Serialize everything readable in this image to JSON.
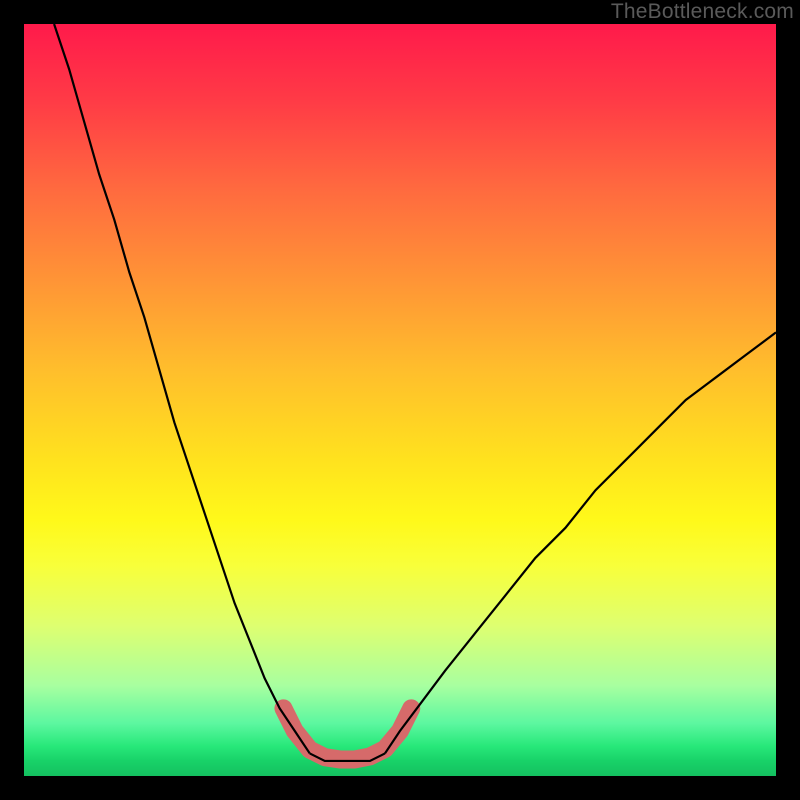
{
  "watermark": {
    "text": "TheBottleneck.com"
  },
  "chart_data": {
    "type": "line",
    "title": "",
    "xlabel": "",
    "ylabel": "",
    "xlim": [
      0,
      100
    ],
    "ylim": [
      0,
      100
    ],
    "grid": false,
    "legend": false,
    "annotations": [],
    "series": [
      {
        "name": "left-branch",
        "x": [
          4,
          6,
          8,
          10,
          12,
          14,
          16,
          18,
          20,
          22,
          24,
          26,
          28,
          30,
          32,
          34,
          36,
          38
        ],
        "y": [
          100,
          94,
          87,
          80,
          74,
          67,
          61,
          54,
          47,
          41,
          35,
          29,
          23,
          18,
          13,
          9,
          6,
          3
        ]
      },
      {
        "name": "flat-bottom",
        "x": [
          38,
          40,
          42,
          44,
          46,
          48
        ],
        "y": [
          3,
          2,
          2,
          2,
          2,
          3
        ]
      },
      {
        "name": "right-branch",
        "x": [
          48,
          50,
          53,
          56,
          60,
          64,
          68,
          72,
          76,
          80,
          84,
          88,
          92,
          96,
          100
        ],
        "y": [
          3,
          6,
          10,
          14,
          19,
          24,
          29,
          33,
          38,
          42,
          46,
          50,
          53,
          56,
          59
        ]
      },
      {
        "name": "highlight-u",
        "x": [
          34.5,
          36,
          38,
          40,
          42,
          44,
          46,
          48,
          50,
          51.5
        ],
        "y": [
          9,
          6,
          3.5,
          2.5,
          2.2,
          2.2,
          2.6,
          3.6,
          6,
          9
        ]
      }
    ],
    "styles": {
      "left-branch": {
        "stroke": "#000000",
        "stroke_width": 2.2
      },
      "flat-bottom": {
        "stroke": "#000000",
        "stroke_width": 2.2
      },
      "right-branch": {
        "stroke": "#000000",
        "stroke_width": 2.2
      },
      "highlight-u": {
        "stroke": "#d66a6a",
        "stroke_width": 18,
        "linecap": "round"
      }
    },
    "background_gradient": {
      "stops": [
        {
          "pct": 0,
          "color": "#ff1a4b"
        },
        {
          "pct": 10,
          "color": "#ff3a46"
        },
        {
          "pct": 22,
          "color": "#ff6a3f"
        },
        {
          "pct": 34,
          "color": "#ff9436"
        },
        {
          "pct": 46,
          "color": "#ffbe2c"
        },
        {
          "pct": 58,
          "color": "#ffe21e"
        },
        {
          "pct": 66,
          "color": "#fff91a"
        },
        {
          "pct": 72,
          "color": "#f8ff3a"
        },
        {
          "pct": 80,
          "color": "#deff70"
        },
        {
          "pct": 88,
          "color": "#a8ffa0"
        },
        {
          "pct": 93,
          "color": "#5cf7a0"
        },
        {
          "pct": 96,
          "color": "#28e87a"
        },
        {
          "pct": 98,
          "color": "#18d268"
        },
        {
          "pct": 100,
          "color": "#14c060"
        }
      ]
    }
  }
}
